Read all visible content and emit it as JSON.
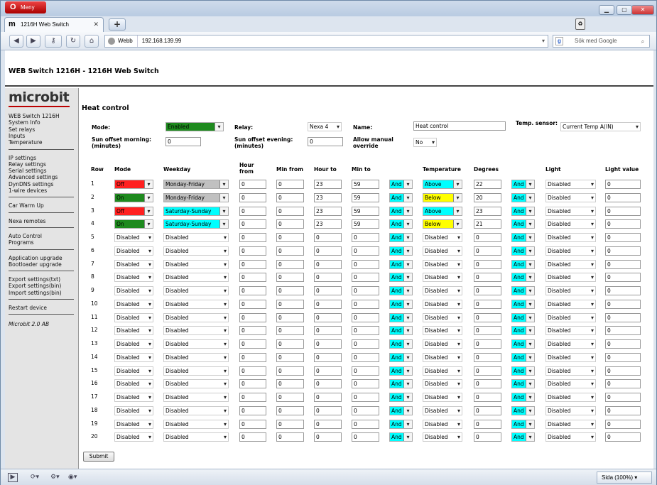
{
  "browser": {
    "menu_label": "Meny",
    "tab_title": "1216H Web Switch",
    "tab_favicon": "m",
    "address_badge": "Webb",
    "url": "192.168.139.99",
    "search_placeholder": "Sök med Google",
    "zoom": "Sida (100%)"
  },
  "page": {
    "header": "WEB Switch 1216H - 1216H Web Switch",
    "title": "Heat control"
  },
  "sidebar": {
    "logo": "microbit",
    "groups": [
      [
        "WEB Switch 1216H",
        "System Info",
        "Set relays",
        "Inputs",
        "Temperature"
      ],
      [
        "IP settings",
        "Relay settings",
        "Serial settings",
        "Advanced settings",
        "DynDNS settings",
        "1-wire devices"
      ],
      [
        "Car Warm Up"
      ],
      [
        "Nexa remotes"
      ],
      [
        "Auto Control",
        "Programs"
      ],
      [
        "Application upgrade",
        "Bootloader upgrade"
      ],
      [
        "Export settings(txt)",
        "Export settings(bin)",
        "Import settings(bin)"
      ],
      [
        "Restart device"
      ]
    ],
    "copyright": "Microbit 2.0 AB"
  },
  "form": {
    "mode_label": "Mode:",
    "mode_value": "Enabled",
    "relay_label": "Relay:",
    "relay_value": "Nexa 4",
    "name_label": "Name:",
    "name_value": "Heat control",
    "temp_sensor_label": "Temp. sensor:",
    "temp_sensor_value": "Current Temp A(IN)",
    "sun_morning_label": "Sun offset morning: (minutes)",
    "sun_morning_value": "0",
    "sun_evening_label": "Sun offset evening: (minutes)",
    "sun_evening_value": "0",
    "manual_override_label": "Allow manual override",
    "manual_override_value": "No",
    "submit_label": "Submit"
  },
  "table": {
    "headers": {
      "row": "Row",
      "mode": "Mode",
      "weekday": "Weekday",
      "hour_from": "Hour from",
      "min_from": "Min from",
      "hour_to": "Hour to",
      "min_to": "Min to",
      "temperature": "Temperature",
      "degrees": "Degrees",
      "light": "Light",
      "light_value": "Light value"
    },
    "rows": [
      {
        "row": "1",
        "mode": "Off",
        "weekday": "Monday-Friday",
        "hour_from": "0",
        "min_from": "0",
        "hour_to": "23",
        "min_to": "59",
        "and1": "And",
        "temperature": "Above",
        "degrees": "22",
        "and2": "And",
        "light": "Disabled",
        "light_value": "0"
      },
      {
        "row": "2",
        "mode": "On",
        "weekday": "Monday-Friday",
        "hour_from": "0",
        "min_from": "0",
        "hour_to": "23",
        "min_to": "59",
        "and1": "And",
        "temperature": "Below",
        "degrees": "20",
        "and2": "And",
        "light": "Disabled",
        "light_value": "0"
      },
      {
        "row": "3",
        "mode": "Off",
        "weekday": "Saturday-Sunday",
        "hour_from": "0",
        "min_from": "0",
        "hour_to": "23",
        "min_to": "59",
        "and1": "And",
        "temperature": "Above",
        "degrees": "23",
        "and2": "And",
        "light": "Disabled",
        "light_value": "0"
      },
      {
        "row": "4",
        "mode": "On",
        "weekday": "Saturday-Sunday",
        "hour_from": "0",
        "min_from": "0",
        "hour_to": "23",
        "min_to": "59",
        "and1": "And",
        "temperature": "Below",
        "degrees": "21",
        "and2": "And",
        "light": "Disabled",
        "light_value": "0"
      },
      {
        "row": "5",
        "mode": "Disabled",
        "weekday": "Disabled",
        "hour_from": "0",
        "min_from": "0",
        "hour_to": "0",
        "min_to": "0",
        "and1": "And",
        "temperature": "Disabled",
        "degrees": "0",
        "and2": "And",
        "light": "Disabled",
        "light_value": "0"
      },
      {
        "row": "6",
        "mode": "Disabled",
        "weekday": "Disabled",
        "hour_from": "0",
        "min_from": "0",
        "hour_to": "0",
        "min_to": "0",
        "and1": "And",
        "temperature": "Disabled",
        "degrees": "0",
        "and2": "And",
        "light": "Disabled",
        "light_value": "0"
      },
      {
        "row": "7",
        "mode": "Disabled",
        "weekday": "Disabled",
        "hour_from": "0",
        "min_from": "0",
        "hour_to": "0",
        "min_to": "0",
        "and1": "And",
        "temperature": "Disabled",
        "degrees": "0",
        "and2": "And",
        "light": "Disabled",
        "light_value": "0"
      },
      {
        "row": "8",
        "mode": "Disabled",
        "weekday": "Disabled",
        "hour_from": "0",
        "min_from": "0",
        "hour_to": "0",
        "min_to": "0",
        "and1": "And",
        "temperature": "Disabled",
        "degrees": "0",
        "and2": "And",
        "light": "Disabled",
        "light_value": "0"
      },
      {
        "row": "9",
        "mode": "Disabled",
        "weekday": "Disabled",
        "hour_from": "0",
        "min_from": "0",
        "hour_to": "0",
        "min_to": "0",
        "and1": "And",
        "temperature": "Disabled",
        "degrees": "0",
        "and2": "And",
        "light": "Disabled",
        "light_value": "0"
      },
      {
        "row": "10",
        "mode": "Disabled",
        "weekday": "Disabled",
        "hour_from": "0",
        "min_from": "0",
        "hour_to": "0",
        "min_to": "0",
        "and1": "And",
        "temperature": "Disabled",
        "degrees": "0",
        "and2": "And",
        "light": "Disabled",
        "light_value": "0"
      },
      {
        "row": "11",
        "mode": "Disabled",
        "weekday": "Disabled",
        "hour_from": "0",
        "min_from": "0",
        "hour_to": "0",
        "min_to": "0",
        "and1": "And",
        "temperature": "Disabled",
        "degrees": "0",
        "and2": "And",
        "light": "Disabled",
        "light_value": "0"
      },
      {
        "row": "12",
        "mode": "Disabled",
        "weekday": "Disabled",
        "hour_from": "0",
        "min_from": "0",
        "hour_to": "0",
        "min_to": "0",
        "and1": "And",
        "temperature": "Disabled",
        "degrees": "0",
        "and2": "And",
        "light": "Disabled",
        "light_value": "0"
      },
      {
        "row": "13",
        "mode": "Disabled",
        "weekday": "Disabled",
        "hour_from": "0",
        "min_from": "0",
        "hour_to": "0",
        "min_to": "0",
        "and1": "And",
        "temperature": "Disabled",
        "degrees": "0",
        "and2": "And",
        "light": "Disabled",
        "light_value": "0"
      },
      {
        "row": "14",
        "mode": "Disabled",
        "weekday": "Disabled",
        "hour_from": "0",
        "min_from": "0",
        "hour_to": "0",
        "min_to": "0",
        "and1": "And",
        "temperature": "Disabled",
        "degrees": "0",
        "and2": "And",
        "light": "Disabled",
        "light_value": "0"
      },
      {
        "row": "15",
        "mode": "Disabled",
        "weekday": "Disabled",
        "hour_from": "0",
        "min_from": "0",
        "hour_to": "0",
        "min_to": "0",
        "and1": "And",
        "temperature": "Disabled",
        "degrees": "0",
        "and2": "And",
        "light": "Disabled",
        "light_value": "0"
      },
      {
        "row": "16",
        "mode": "Disabled",
        "weekday": "Disabled",
        "hour_from": "0",
        "min_from": "0",
        "hour_to": "0",
        "min_to": "0",
        "and1": "And",
        "temperature": "Disabled",
        "degrees": "0",
        "and2": "And",
        "light": "Disabled",
        "light_value": "0"
      },
      {
        "row": "17",
        "mode": "Disabled",
        "weekday": "Disabled",
        "hour_from": "0",
        "min_from": "0",
        "hour_to": "0",
        "min_to": "0",
        "and1": "And",
        "temperature": "Disabled",
        "degrees": "0",
        "and2": "And",
        "light": "Disabled",
        "light_value": "0"
      },
      {
        "row": "18",
        "mode": "Disabled",
        "weekday": "Disabled",
        "hour_from": "0",
        "min_from": "0",
        "hour_to": "0",
        "min_to": "0",
        "and1": "And",
        "temperature": "Disabled",
        "degrees": "0",
        "and2": "And",
        "light": "Disabled",
        "light_value": "0"
      },
      {
        "row": "19",
        "mode": "Disabled",
        "weekday": "Disabled",
        "hour_from": "0",
        "min_from": "0",
        "hour_to": "0",
        "min_to": "0",
        "and1": "And",
        "temperature": "Disabled",
        "degrees": "0",
        "and2": "And",
        "light": "Disabled",
        "light_value": "0"
      },
      {
        "row": "20",
        "mode": "Disabled",
        "weekday": "Disabled",
        "hour_from": "0",
        "min_from": "0",
        "hour_to": "0",
        "min_to": "0",
        "and1": "And",
        "temperature": "Disabled",
        "degrees": "0",
        "and2": "And",
        "light": "Disabled",
        "light_value": "0"
      }
    ]
  },
  "colors": {
    "on": "#1e8a1e",
    "off": "#ff2020",
    "weekday_workdays": "#c0c0c0",
    "weekday_weekend": "#00ffff",
    "and": "#00ffff",
    "above": "#00ffff",
    "below": "#ffff00",
    "enabled": "#1e8a1e",
    "logo_underline": "#bb0000"
  },
  "icons": {
    "back": "arrow-left-icon",
    "forward": "arrow-right-icon",
    "key": "key-icon",
    "reload": "reload-icon",
    "home": "home-icon",
    "search": "search-icon",
    "trash": "trash-icon"
  }
}
